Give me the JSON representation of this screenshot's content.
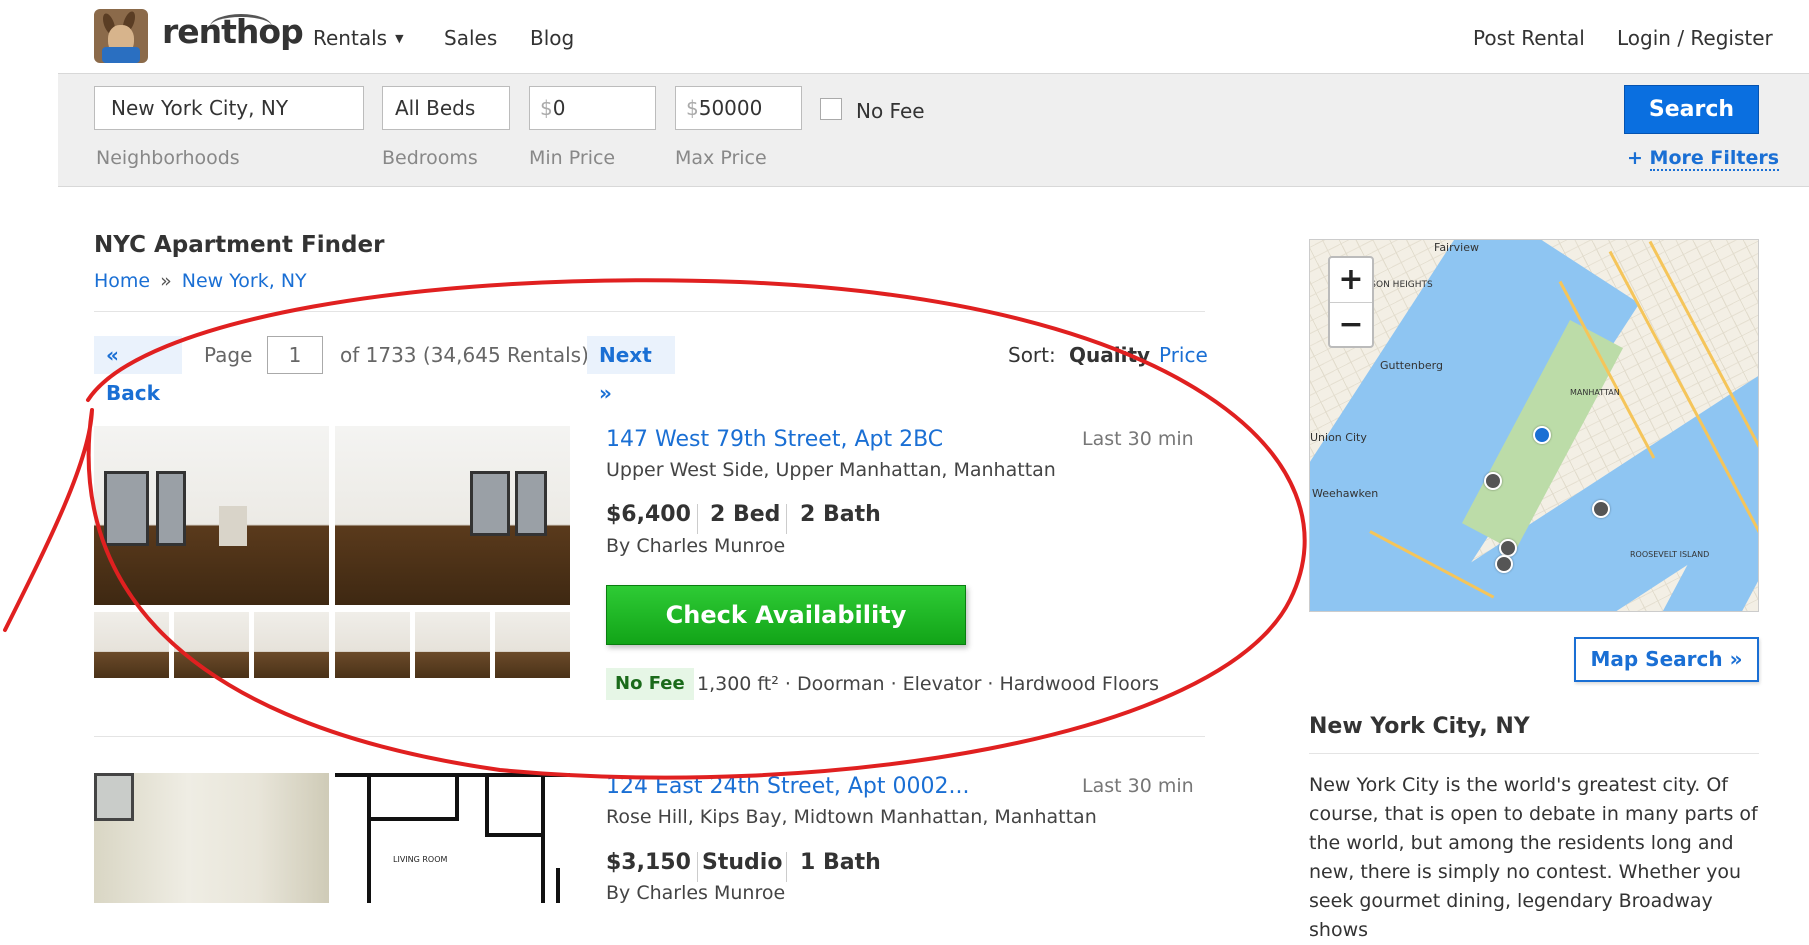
{
  "header": {
    "logo_text": "renthop",
    "nav": {
      "rentals": "Rentals",
      "sales": "Sales",
      "blog": "Blog",
      "post_rental": "Post Rental",
      "login": "Login / Register"
    }
  },
  "search": {
    "neighborhood_value": "New York City, NY",
    "beds_value": "All Beds",
    "min_price_prefix": "$",
    "min_price_value": "0",
    "max_price_prefix": "$",
    "max_price_value": "50000",
    "no_fee_label": "No Fee",
    "no_fee_checked": false,
    "labels": {
      "neighborhoods": "Neighborhoods",
      "bedrooms": "Bedrooms",
      "min_price": "Min Price",
      "max_price": "Max Price"
    },
    "search_button": "Search",
    "more_filters_plus": "+",
    "more_filters": "More Filters"
  },
  "page": {
    "title": "NYC Apartment Finder",
    "breadcrumb": {
      "home": "Home",
      "sep": "»",
      "city": "New York, NY"
    }
  },
  "pager": {
    "back": "« Back",
    "page_word": "Page",
    "page_value": "1",
    "of_text": "of 1733 (34,645 Rentals)",
    "next": "Next »",
    "sort_label": "Sort:",
    "sort_quality": "Quality",
    "sort_price": "Price"
  },
  "listings": [
    {
      "title": "147 West 79th Street, Apt 2BC",
      "time": "Last 30 min",
      "neighborhood": "Upper West Side, Upper Manhattan, Manhattan",
      "price": "$6,400",
      "beds": "2 Bed",
      "baths": "2 Bath",
      "agent": "By Charles Munroe",
      "cta": "Check Availability",
      "badge": "No Fee",
      "amenities": "1,300 ft² · Doorman · Elevator · Hardwood Floors"
    },
    {
      "title": "124 East 24th Street, Apt 0002...",
      "time": "Last 30 min",
      "neighborhood": "Rose Hill, Kips Bay, Midtown Manhattan, Manhattan",
      "price": "$3,150",
      "beds": "Studio",
      "baths": "1 Bath",
      "agent": "By Charles Munroe",
      "floorplan_label": "LIVING ROOM"
    }
  ],
  "map": {
    "zoom_in": "+",
    "zoom_out": "−",
    "labels": {
      "fairview": "Fairview",
      "hudson_heights": "HUDSON HEIGHTS",
      "guttenberg": "Guttenberg",
      "union_city": "Union City",
      "weehawken": "Weehawken",
      "manhattan": "MANHATTAN",
      "roosevelt_island": "ROOSEVELT ISLAND"
    },
    "map_search_button": "Map Search »"
  },
  "city": {
    "title": "New York City, NY",
    "description": "New York City is the world's greatest city. Of course, that is open to debate in many parts of the world, but among the residents long and new, there is simply no contest. Whether you seek gourmet dining, legendary Broadway shows"
  },
  "colors": {
    "link_blue": "#1a6fd4",
    "search_blue": "#0a6fe0",
    "cta_green": "#1db724",
    "annotation_red": "#e02020"
  }
}
